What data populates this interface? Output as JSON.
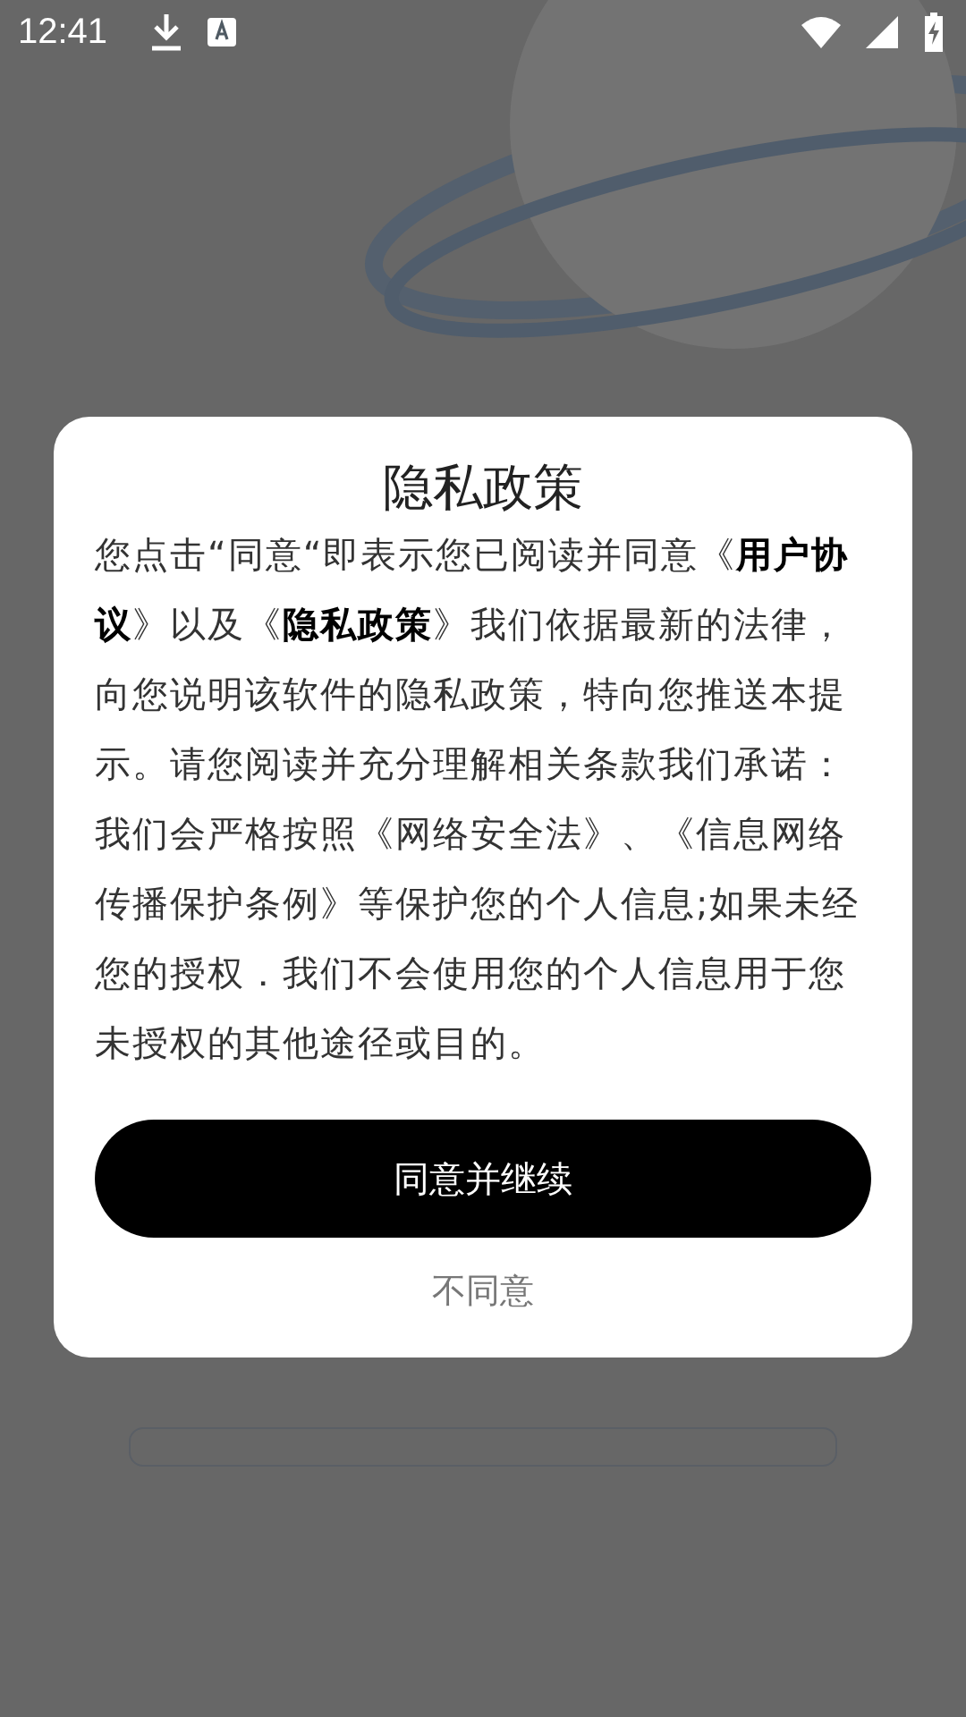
{
  "status_bar": {
    "time": "12:41"
  },
  "dialog": {
    "title": "隐私政策",
    "body": "您点击“同意“即表示您已阅读并同意《**用户协议**》以及《**隐私政策**》我们依据最新的法律，向您说明该软件的隐私政策，特向您推送本提示。请您阅读并充分理解相关条款我们承诺：我们会严格按照《网络安全法》、《信息网络传播保护条例》等保护您的个人信息;如果未经您的授权．我们不会使用您的个人信息用于您未授权的其他途径或目的。",
    "agree_button": "同意并继续",
    "decline_button": "不同意"
  }
}
